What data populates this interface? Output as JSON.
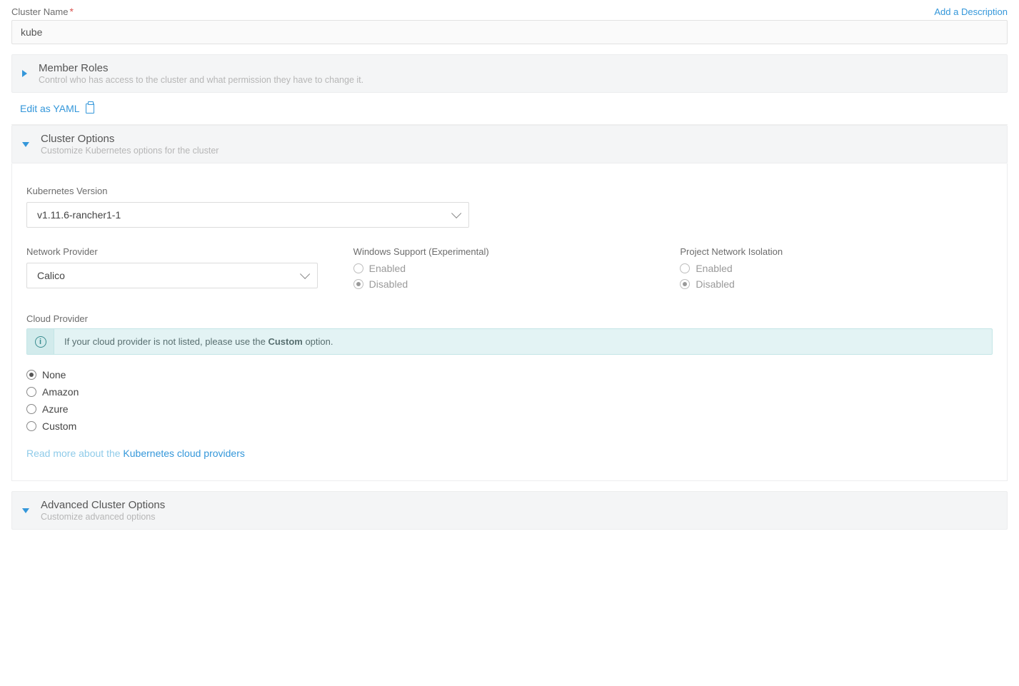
{
  "labels": {
    "clusterName": "Cluster Name",
    "addDescription": "Add a Description",
    "editYaml": "Edit as YAML",
    "kubeVersion": "Kubernetes Version",
    "netProvider": "Network Provider",
    "winSupport": "Windows Support (Experimental)",
    "projNetIso": "Project Network Isolation",
    "cloudProvider": "Cloud Provider",
    "readMorePrefix": "Read more about the ",
    "readMoreLink": "Kubernetes cloud providers"
  },
  "values": {
    "clusterName": "kube",
    "kubeVersion": "v1.11.6-rancher1-1",
    "netProvider": "Calico"
  },
  "sections": {
    "memberRoles": {
      "title": "Member Roles",
      "sub": "Control who has access to the cluster and what permission they have to change it."
    },
    "clusterOptions": {
      "title": "Cluster Options",
      "sub": "Customize Kubernetes options for the cluster"
    },
    "advanced": {
      "title": "Advanced Cluster Options",
      "sub": "Customize advanced options"
    }
  },
  "radios": {
    "enabled": "Enabled",
    "disabled": "Disabled"
  },
  "cloud": {
    "infoPrefix": "If your cloud provider is not listed, please use the ",
    "infoBold": "Custom",
    "infoSuffix": " option.",
    "opts": {
      "none": "None",
      "amazon": "Amazon",
      "azure": "Azure",
      "custom": "Custom"
    }
  }
}
